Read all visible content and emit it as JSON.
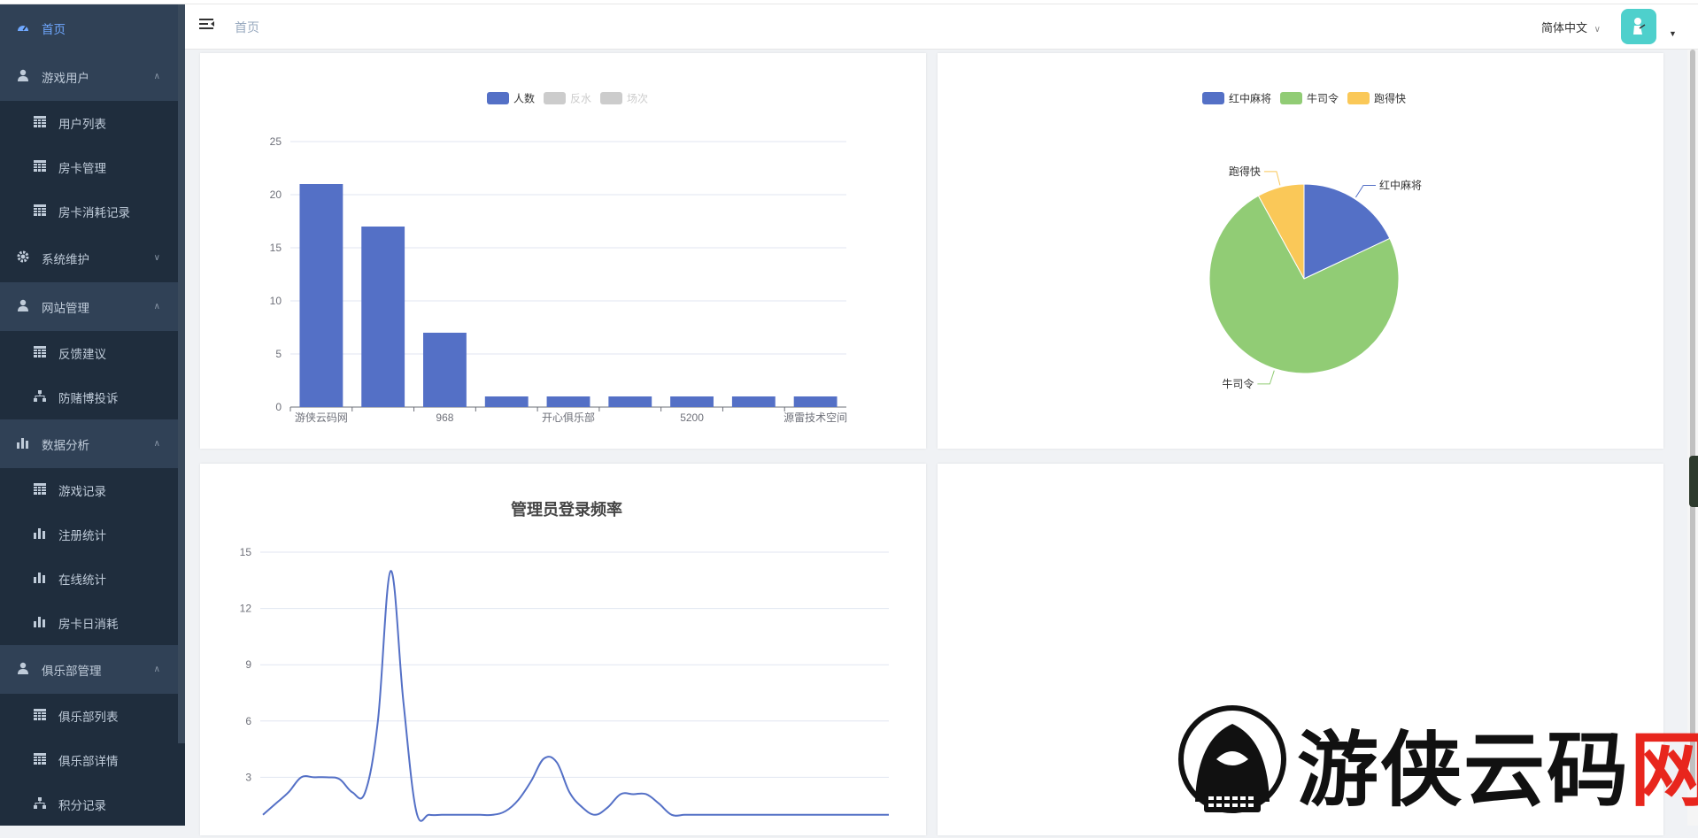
{
  "sidebar": {
    "items": [
      {
        "label": "首页",
        "type": "top",
        "icon": "dashboard-icon",
        "active": true
      },
      {
        "label": "游戏用户",
        "type": "top",
        "icon": "user-icon",
        "arrow": "up"
      },
      {
        "label": "用户列表",
        "type": "sub",
        "icon": "table-icon"
      },
      {
        "label": "房卡管理",
        "type": "sub",
        "icon": "table-icon"
      },
      {
        "label": "房卡消耗记录",
        "type": "sub",
        "icon": "table-icon"
      },
      {
        "label": "系统维护",
        "type": "top",
        "icon": "gear-icon",
        "arrow": "down"
      },
      {
        "label": "网站管理",
        "type": "top",
        "icon": "user-icon",
        "arrow": "up"
      },
      {
        "label": "反馈建议",
        "type": "sub",
        "icon": "table-icon"
      },
      {
        "label": "防赌博投诉",
        "type": "sub",
        "icon": "tree-icon"
      },
      {
        "label": "数据分析",
        "type": "top",
        "icon": "bar-chart-icon",
        "arrow": "up"
      },
      {
        "label": "游戏记录",
        "type": "sub",
        "icon": "table-icon"
      },
      {
        "label": "注册统计",
        "type": "sub",
        "icon": "bar-chart-icon"
      },
      {
        "label": "在线统计",
        "type": "sub",
        "icon": "bar-chart-icon"
      },
      {
        "label": "房卡日消耗",
        "type": "sub",
        "icon": "bar-chart-icon"
      },
      {
        "label": "俱乐部管理",
        "type": "top",
        "icon": "user-icon",
        "arrow": "up"
      },
      {
        "label": "俱乐部列表",
        "type": "sub",
        "icon": "table-icon"
      },
      {
        "label": "俱乐部详情",
        "type": "sub",
        "icon": "table-icon"
      },
      {
        "label": "积分记录",
        "type": "sub",
        "icon": "tree-icon"
      }
    ]
  },
  "header": {
    "breadcrumb": "首页",
    "language": "简体中文"
  },
  "colors": {
    "blue": "#5470c6",
    "green": "#91cc75",
    "yellow": "#fac858",
    "sidebar": "#1f2d3d",
    "sidebar_group": "#304156"
  },
  "chart_data": [
    {
      "type": "bar",
      "legend": [
        "人数",
        "反水",
        "场次"
      ],
      "legend_active": [
        true,
        false,
        false
      ],
      "categories": [
        "游侠云码网",
        "",
        "968",
        "",
        "开心俱乐部",
        "",
        "5200",
        "",
        "源雷技术空间"
      ],
      "series": [
        {
          "name": "人数",
          "values": [
            21,
            17,
            7,
            1,
            1,
            1,
            1,
            1,
            1
          ]
        }
      ],
      "ylim": [
        0,
        25
      ],
      "yticks": [
        0,
        5,
        10,
        15,
        20,
        25
      ]
    },
    {
      "type": "pie",
      "legend": [
        "红中麻将",
        "牛司令",
        "跑得快"
      ],
      "values": [
        18,
        74,
        8
      ]
    },
    {
      "type": "line",
      "title": "管理员登录频率",
      "ylim": [
        0,
        15
      ],
      "yticks": [
        3,
        6,
        9,
        12,
        15
      ],
      "values": [
        1,
        1.6,
        2.2,
        3,
        3,
        3,
        2.9,
        2.2,
        2.2,
        6,
        14,
        7,
        1.2,
        1,
        1,
        1,
        1,
        1,
        1,
        1.2,
        1.8,
        2.8,
        4,
        3.8,
        2.2,
        1.4,
        1,
        1.4,
        2.1,
        2.1,
        2.1,
        1.6,
        1,
        1,
        1,
        1,
        1,
        1,
        1,
        1,
        1,
        1,
        1,
        1,
        1,
        1,
        1,
        1,
        1,
        1
      ]
    }
  ],
  "watermark": {
    "text_main": "游侠云码",
    "text_accent": "网"
  }
}
